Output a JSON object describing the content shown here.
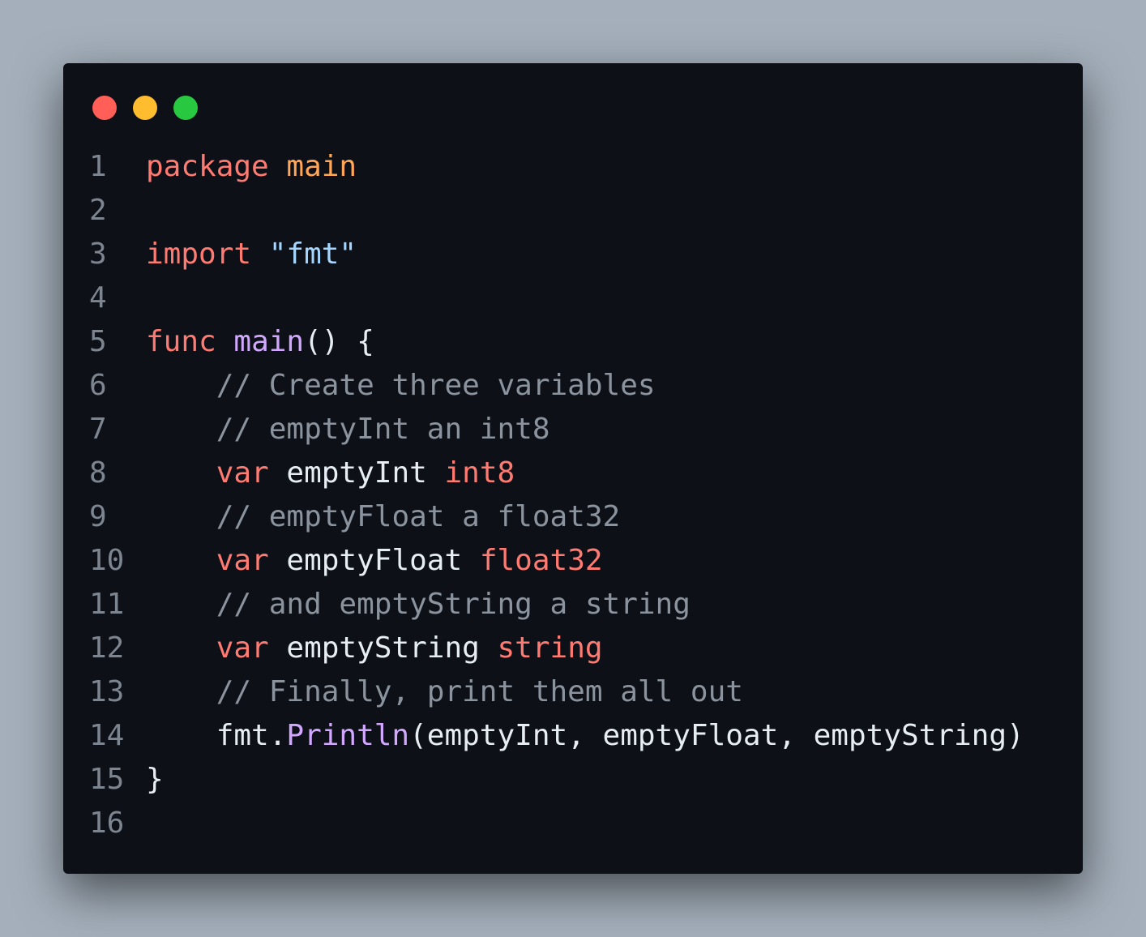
{
  "window": {
    "controls": {
      "close_color": "#ff5f57",
      "minimize_color": "#febc2e",
      "maximize_color": "#28c840"
    }
  },
  "code": {
    "language": "go",
    "lines": [
      {
        "number": "1",
        "tokens": [
          {
            "t": "package",
            "k": "keyword"
          },
          {
            "t": " ",
            "k": "punct"
          },
          {
            "t": "main",
            "k": "pkg"
          }
        ]
      },
      {
        "number": "2",
        "tokens": []
      },
      {
        "number": "3",
        "tokens": [
          {
            "t": "import",
            "k": "keyword"
          },
          {
            "t": " ",
            "k": "punct"
          },
          {
            "t": "\"fmt\"",
            "k": "string"
          }
        ]
      },
      {
        "number": "4",
        "tokens": []
      },
      {
        "number": "5",
        "tokens": [
          {
            "t": "func",
            "k": "keyword"
          },
          {
            "t": " ",
            "k": "punct"
          },
          {
            "t": "main",
            "k": "func"
          },
          {
            "t": "() {",
            "k": "punct"
          }
        ]
      },
      {
        "number": "6",
        "tokens": [
          {
            "t": "    ",
            "k": "punct"
          },
          {
            "t": "// Create three variables",
            "k": "comment"
          }
        ]
      },
      {
        "number": "7",
        "tokens": [
          {
            "t": "    ",
            "k": "punct"
          },
          {
            "t": "// emptyInt an int8",
            "k": "comment"
          }
        ]
      },
      {
        "number": "8",
        "tokens": [
          {
            "t": "    ",
            "k": "punct"
          },
          {
            "t": "var",
            "k": "keyword"
          },
          {
            "t": " emptyInt ",
            "k": "ident"
          },
          {
            "t": "int8",
            "k": "type"
          }
        ]
      },
      {
        "number": "9",
        "tokens": [
          {
            "t": "    ",
            "k": "punct"
          },
          {
            "t": "// emptyFloat a float32",
            "k": "comment"
          }
        ]
      },
      {
        "number": "10",
        "tokens": [
          {
            "t": "    ",
            "k": "punct"
          },
          {
            "t": "var",
            "k": "keyword"
          },
          {
            "t": " emptyFloat ",
            "k": "ident"
          },
          {
            "t": "float32",
            "k": "type"
          }
        ]
      },
      {
        "number": "11",
        "tokens": [
          {
            "t": "    ",
            "k": "punct"
          },
          {
            "t": "// and emptyString a string",
            "k": "comment"
          }
        ]
      },
      {
        "number": "12",
        "tokens": [
          {
            "t": "    ",
            "k": "punct"
          },
          {
            "t": "var",
            "k": "keyword"
          },
          {
            "t": " emptyString ",
            "k": "ident"
          },
          {
            "t": "string",
            "k": "type"
          }
        ]
      },
      {
        "number": "13",
        "tokens": [
          {
            "t": "    ",
            "k": "punct"
          },
          {
            "t": "// Finally, print them all out",
            "k": "comment"
          }
        ]
      },
      {
        "number": "14",
        "tokens": [
          {
            "t": "    fmt.",
            "k": "ident"
          },
          {
            "t": "Println",
            "k": "func"
          },
          {
            "t": "(emptyInt, emptyFloat, emptyString)",
            "k": "ident"
          }
        ]
      },
      {
        "number": "15",
        "tokens": [
          {
            "t": "}",
            "k": "punct"
          }
        ]
      },
      {
        "number": "16",
        "tokens": []
      }
    ]
  },
  "colors": {
    "background": "#a4afbb",
    "window_bg": "#0d1017",
    "line_number": "#7d8590",
    "keyword": "#ff7b72",
    "package_name": "#ffa657",
    "string": "#a5d6ff",
    "function": "#d2a8ff",
    "comment": "#8b949e",
    "identifier": "#e6edf3"
  }
}
